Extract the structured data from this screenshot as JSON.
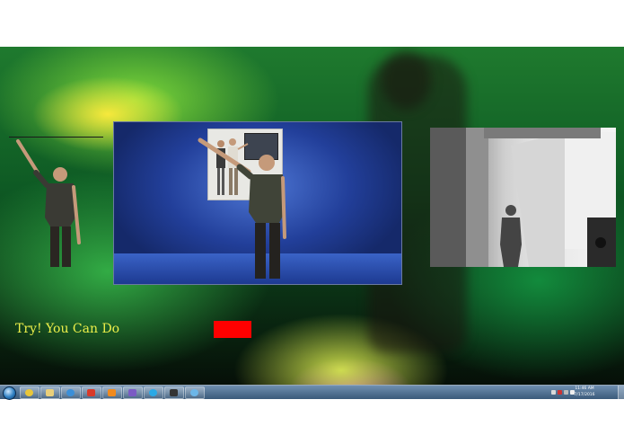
{
  "app": {
    "left_panel": {
      "avatar": "avatar-left-arm-raised"
    },
    "center_panel": {
      "scene": "virtual-room-with-avatar",
      "poster": "instruction-poster"
    },
    "right_panel": {
      "scene": "depth-camera-view"
    },
    "prompt_text": "Try! You Can Do",
    "status_indicator_color": "#ff0000"
  },
  "taskbar": {
    "start_button": "windows-start-orb",
    "pinned": [
      {
        "icon": "chrome-icon",
        "color": "#e8c63a"
      },
      {
        "icon": "file-explorer-icon",
        "color": "#e9cf7a"
      },
      {
        "icon": "internet-explorer-icon",
        "color": "#3b8fd8"
      },
      {
        "icon": "app-star-icon",
        "color": "#d83a2a"
      },
      {
        "icon": "media-player-icon",
        "color": "#f08a1e"
      },
      {
        "icon": "visual-studio-icon",
        "color": "#7a5bc4"
      },
      {
        "icon": "skype-icon",
        "color": "#2aa9e6"
      },
      {
        "icon": "terminal-icon",
        "color": "#333333"
      },
      {
        "icon": "network-globe-icon",
        "color": "#6cb6e8"
      }
    ],
    "clock": {
      "time": "11:46 AM",
      "date": "7/17/2016"
    }
  }
}
